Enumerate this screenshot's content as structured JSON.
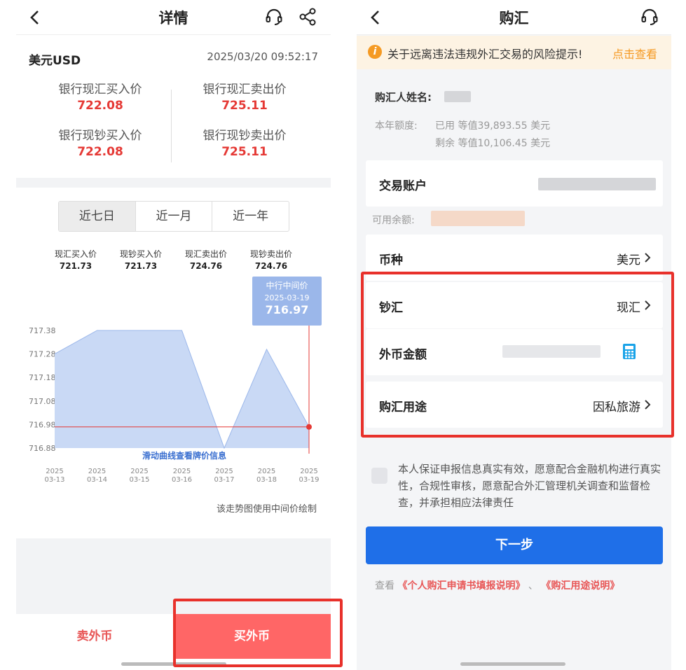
{
  "left": {
    "nav": {
      "title": "详情"
    },
    "currency": {
      "name": "美元USD",
      "time": "2025/03/20 09:52:17"
    },
    "rates": [
      {
        "label": "银行现汇买入价",
        "value": "722.08"
      },
      {
        "label": "银行现汇卖出价",
        "value": "725.11"
      },
      {
        "label": "银行现钞买入价",
        "value": "722.08"
      },
      {
        "label": "银行现钞卖出价",
        "value": "725.11"
      }
    ],
    "periods": [
      "近七日",
      "近一月",
      "近一年"
    ],
    "summary": [
      {
        "label": "现汇买入价",
        "value": "721.73"
      },
      {
        "label": "现钞买入价",
        "value": "721.73"
      },
      {
        "label": "现汇卖出价",
        "value": "724.76"
      },
      {
        "label": "现钞卖出价",
        "value": "724.76"
      }
    ],
    "tooltip": {
      "title": "中行中间价",
      "date": "2025-03-19",
      "value": "716.97"
    },
    "chart_note": "该走势图使用中间价绘制",
    "bottom": {
      "sell": "卖外币",
      "buy": "买外币"
    }
  },
  "chart_data": {
    "type": "area",
    "x": [
      "2025-03-13",
      "2025-03-14",
      "2025-03-15",
      "2025-03-16",
      "2025-03-17",
      "2025-03-18",
      "2025-03-19"
    ],
    "x_ticks": [
      {
        "year": "2025",
        "md": "03-13"
      },
      {
        "year": "2025",
        "md": "03-14"
      },
      {
        "year": "2025",
        "md": "03-15"
      },
      {
        "year": "2025",
        "md": "03-16"
      },
      {
        "year": "2025",
        "md": "03-17"
      },
      {
        "year": "2025",
        "md": "03-18"
      },
      {
        "year": "2025",
        "md": "03-19"
      }
    ],
    "values": [
      717.28,
      717.38,
      717.38,
      717.38,
      716.88,
      717.3,
      716.97
    ],
    "y_ticks": [
      "717.38",
      "717.28",
      "717.18",
      "717.08",
      "716.98",
      "716.88"
    ],
    "ylim": [
      716.88,
      717.38
    ],
    "overlay_text": "滑动曲线查看牌价信息",
    "fill_color": "#c9d9f5",
    "line_color": "#9bb7ea",
    "marker_color": "#e53935",
    "grid": false
  },
  "right": {
    "nav": {
      "title": "购汇"
    },
    "warning": {
      "text": "关于远离违法违规外汇交易的风险提示!",
      "link": "点击查看"
    },
    "buyer_label": "购汇人姓名:",
    "quota": {
      "label": "本年额度:",
      "used": "已用 等值39,893.55 美元",
      "remaining": "剩余 等值10,106.45 美元"
    },
    "account_label": "交易账户",
    "available_label": "可用余额:",
    "currency_row": {
      "label": "币种",
      "value": "美元"
    },
    "cash_row": {
      "label": "钞汇",
      "value": "现汇"
    },
    "amount_row": {
      "label": "外币金额"
    },
    "purpose_row": {
      "label": "购汇用途",
      "value": "因私旅游"
    },
    "declaration": "本人保证申报信息真实有效，愿意配合金融机构进行真实性，合规性审核，愿意配合外汇管理机关调查和监督检查，并承担相应法律责任",
    "next": "下一步",
    "see": {
      "prefix": "查看",
      "link1": "《个人购汇申请书填报说明》",
      "sep": "、",
      "link2": "《购汇用途说明》"
    }
  }
}
